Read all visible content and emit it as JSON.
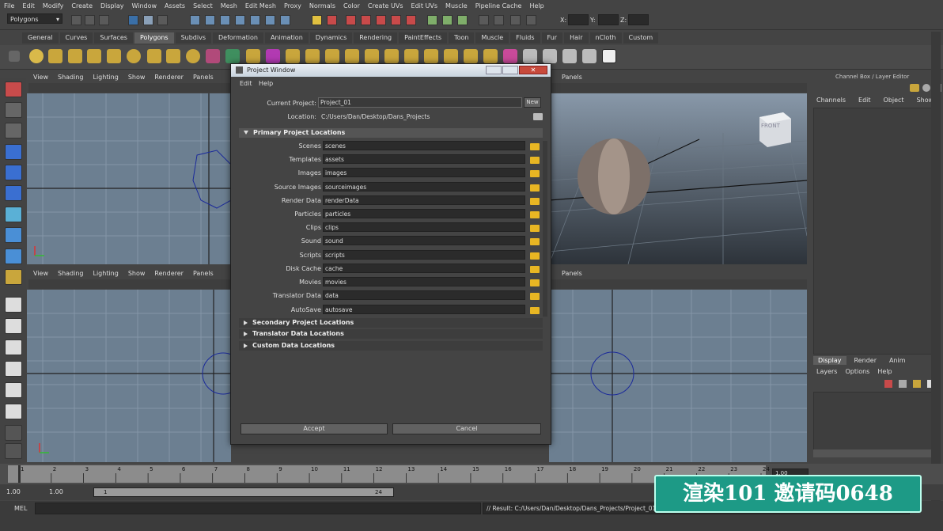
{
  "menubar": [
    "File",
    "Edit",
    "Modify",
    "Create",
    "Display",
    "Window",
    "Assets",
    "Select",
    "Mesh",
    "Edit Mesh",
    "Proxy",
    "Normals",
    "Color",
    "Create UVs",
    "Edit UVs",
    "Muscle",
    "Pipeline Cache",
    "Help"
  ],
  "status_line": {
    "mode": "Polygons",
    "x_label": "X:",
    "y_label": "Y:",
    "z_label": "Z:"
  },
  "shelf_tabs": [
    "General",
    "Curves",
    "Surfaces",
    "Polygons",
    "Subdivs",
    "Deformation",
    "Animation",
    "Dynamics",
    "Rendering",
    "PaintEffects",
    "Toon",
    "Muscle",
    "Fluids",
    "Fur",
    "Hair",
    "nCloth",
    "Custom"
  ],
  "shelf_active": "Polygons",
  "viewport_menu": [
    "View",
    "Shading",
    "Lighting",
    "Show",
    "Renderer",
    "Panels"
  ],
  "viewport_right_menu": "Panels",
  "viewcube_label": "FRONT",
  "channel_box": {
    "title": "Channel Box / Layer Editor",
    "menu": [
      "Channels",
      "Edit",
      "Object",
      "Show"
    ],
    "layer_tabs": [
      "Display",
      "Render",
      "Anim"
    ],
    "layer_menu": [
      "Layers",
      "Options",
      "Help"
    ]
  },
  "timeline": {
    "ticks": [
      1,
      2,
      3,
      4,
      5,
      6,
      7,
      8,
      9,
      10,
      11,
      12,
      13,
      14,
      15,
      16,
      17,
      18,
      19,
      20,
      21,
      22,
      23,
      24
    ],
    "current_frame": "1.00",
    "range_start": "1.00",
    "range_start2": "1.00",
    "range_inner_start": "1",
    "range_inner_end": "24"
  },
  "command_line": {
    "label": "MEL",
    "result": "// Result: C:/Users/Dan/Desktop/Dans_Projects/Project_01/scenes/testScene.mb"
  },
  "dialog": {
    "title": "Project Window",
    "menu": [
      "Edit",
      "Help"
    ],
    "current_project_label": "Current Project:",
    "current_project_value": "Project_01",
    "new_button": "New",
    "location_label": "Location:",
    "location_value": "C:/Users/Dan/Desktop/Dans_Projects",
    "primary_header": "Primary Project Locations",
    "primary": [
      {
        "label": "Scenes",
        "value": "scenes"
      },
      {
        "label": "Templates",
        "value": "assets"
      },
      {
        "label": "Images",
        "value": "images"
      },
      {
        "label": "Source Images",
        "value": "sourceimages"
      },
      {
        "label": "Render Data",
        "value": "renderData"
      },
      {
        "label": "Particles",
        "value": "particles"
      },
      {
        "label": "Clips",
        "value": "clips"
      },
      {
        "label": "Sound",
        "value": "sound"
      },
      {
        "label": "Scripts",
        "value": "scripts"
      },
      {
        "label": "Disk Cache",
        "value": "cache"
      },
      {
        "label": "Movies",
        "value": "movies"
      },
      {
        "label": "Translator Data",
        "value": "data"
      },
      {
        "label": "AutoSave",
        "value": "autosave"
      }
    ],
    "secondary_header": "Secondary Project Locations",
    "translator_header": "Translator Data Locations",
    "custom_header": "Custom Data Locations",
    "accept_button": "Accept",
    "cancel_button": "Cancel"
  },
  "watermark": "渲染101 邀请码0648",
  "colors": {
    "viewport_bg": "#6c7f91",
    "folder": "#e8b623",
    "watermark_bg": "#1d9a86"
  }
}
